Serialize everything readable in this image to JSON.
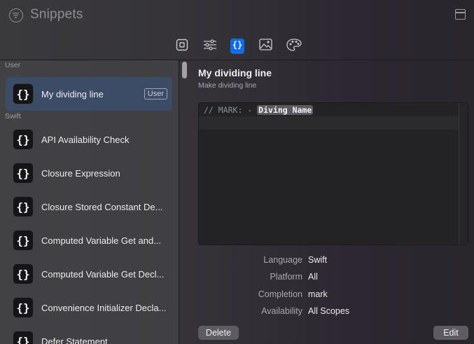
{
  "window": {
    "title": "Snippets"
  },
  "toolbar": {
    "buttons": [
      {
        "icon": "square-icon",
        "active": false
      },
      {
        "icon": "sliders-icon",
        "active": false
      },
      {
        "icon": "braces-icon",
        "active": true
      },
      {
        "icon": "image-icon",
        "active": false
      },
      {
        "icon": "palette-icon",
        "active": false
      }
    ]
  },
  "sidebar": {
    "sections": [
      {
        "label": "User",
        "items": [
          {
            "icon": "{}",
            "label": "My dividing line",
            "badge": "User",
            "selected": true
          }
        ]
      },
      {
        "label": "Swift",
        "items": [
          {
            "icon": "{}",
            "label": "API Availability Check"
          },
          {
            "icon": "{}",
            "label": "Closure Expression"
          },
          {
            "icon": "{}",
            "label": "Closure Stored Constant De..."
          },
          {
            "icon": "{}",
            "label": "Computed Variable Get and..."
          },
          {
            "icon": "{}",
            "label": "Computed Variable Get Decl..."
          },
          {
            "icon": "{}",
            "label": "Convenience Initializer Decla..."
          },
          {
            "icon": "{}",
            "label": "Defer Statement"
          }
        ]
      }
    ]
  },
  "detail": {
    "title": "My dividing line",
    "subtitle": "Make dividing line",
    "code": {
      "prefix": "// MARK: - ",
      "token": "Diving Name"
    },
    "properties": [
      {
        "label": "Language",
        "value": "Swift"
      },
      {
        "label": "Platform",
        "value": "All"
      },
      {
        "label": "Completion",
        "value": "mark"
      },
      {
        "label": "Availability",
        "value": "All Scopes"
      }
    ],
    "delete_label": "Delete",
    "edit_label": "Edit"
  },
  "colors": {
    "accent": "#0a6cff",
    "selection": "#3c4c66"
  }
}
